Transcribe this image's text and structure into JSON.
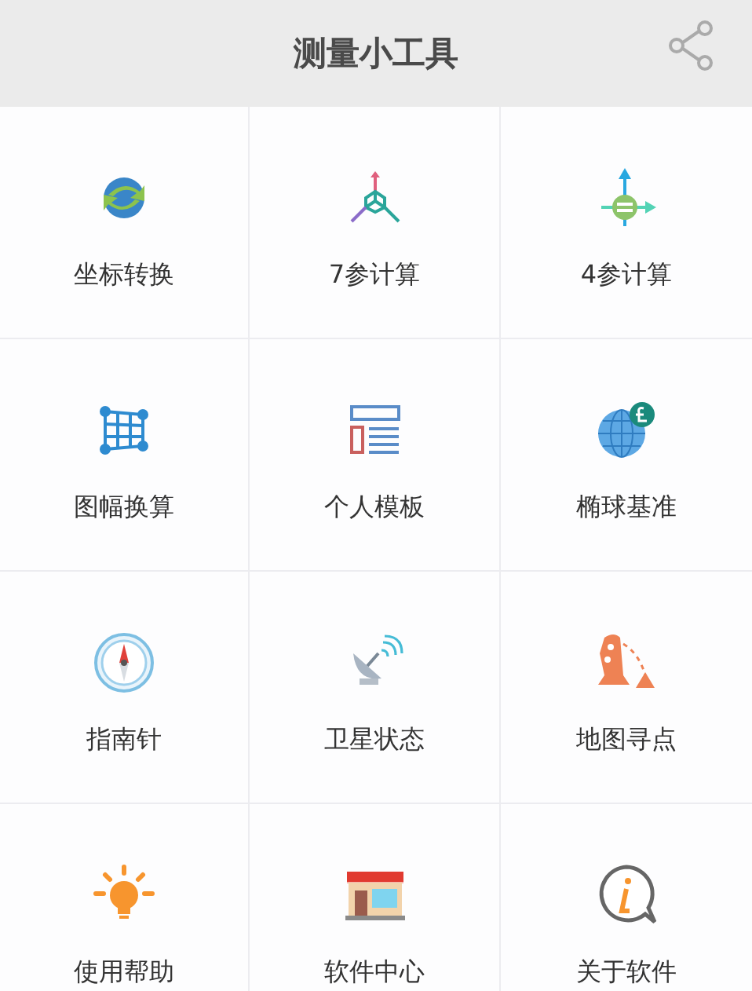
{
  "header": {
    "title": "测量小工具"
  },
  "tools": [
    {
      "label": "坐标转换"
    },
    {
      "label": "7参计算"
    },
    {
      "label": "4参计算"
    },
    {
      "label": "图幅换算"
    },
    {
      "label": "个人模板"
    },
    {
      "label": "椭球基准"
    },
    {
      "label": "指南针"
    },
    {
      "label": "卫星状态"
    },
    {
      "label": "地图寻点"
    },
    {
      "label": "使用帮助"
    },
    {
      "label": "软件中心"
    },
    {
      "label": "关于软件"
    }
  ]
}
